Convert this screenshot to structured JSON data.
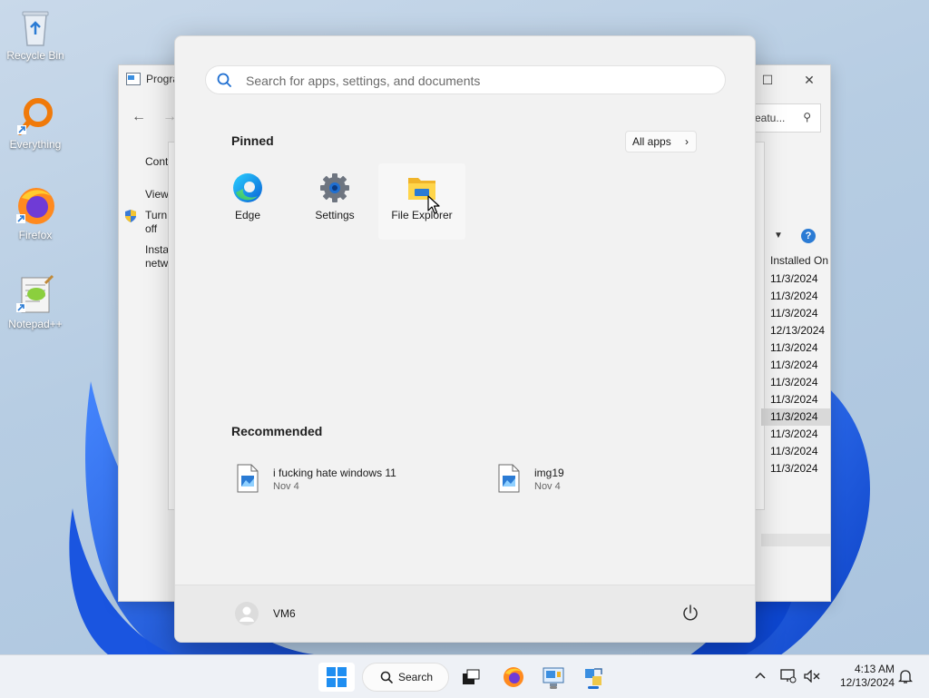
{
  "desktop": {
    "icons": [
      {
        "label": "Recycle Bin"
      },
      {
        "label": "Everything"
      },
      {
        "label": "Firefox"
      },
      {
        "label": "Notepad++"
      }
    ]
  },
  "background_window": {
    "title": "Progra",
    "sidebar": [
      "Cont",
      "View",
      "Turn off",
      "Insta netw"
    ],
    "search_partial": "eatu...",
    "column_header": "Installed On",
    "dates": [
      "11/3/2024",
      "11/3/2024",
      "11/3/2024",
      "12/13/2024",
      "11/3/2024",
      "11/3/2024",
      "11/3/2024",
      "11/3/2024",
      "11/3/2024",
      "11/3/2024",
      "11/3/2024",
      "11/3/2024"
    ],
    "selected_row": 8,
    "help_label": "?"
  },
  "start_menu": {
    "search_placeholder": "Search for apps, settings, and documents",
    "pinned_title": "Pinned",
    "all_apps_label": "All apps",
    "pinned": [
      {
        "label": "Edge",
        "icon": "edge-icon"
      },
      {
        "label": "Settings",
        "icon": "gear-icon"
      },
      {
        "label": "File Explorer",
        "icon": "folder-icon"
      }
    ],
    "recommended_title": "Recommended",
    "recommended": [
      {
        "name": "i fucking hate windows 11",
        "date": "Nov 4",
        "icon": "image-file-icon"
      },
      {
        "name": "img19",
        "date": "Nov 4",
        "icon": "image-file-icon"
      }
    ],
    "user_name": "VM6"
  },
  "taskbar": {
    "search_label": "Search",
    "time": "4:13 AM",
    "date": "12/13/2024"
  },
  "colors": {
    "accent": "#1f6fd1",
    "menu_bg": "#f2f2f2",
    "taskbar_bg": "#eef1f6"
  }
}
